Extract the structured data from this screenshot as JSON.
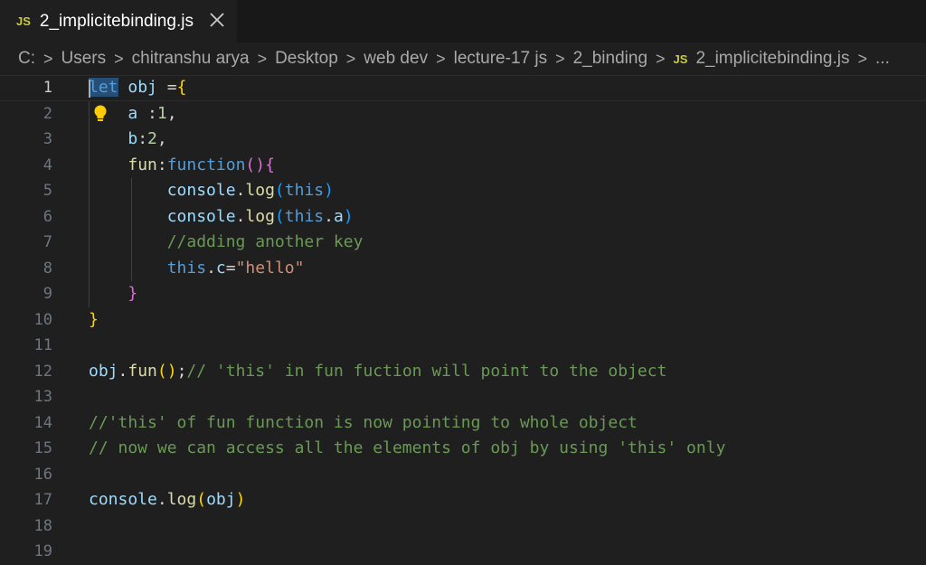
{
  "tab": {
    "badge": "JS",
    "title": "2_implicitebinding.js"
  },
  "breadcrumb": {
    "items": [
      "C:",
      "Users",
      "chitranshu arya",
      "Desktop",
      "web dev",
      "lecture-17 js",
      "2_binding"
    ],
    "file_badge": "JS",
    "file": "2_implicitebinding.js",
    "more": "..."
  },
  "editor": {
    "active_line": 1,
    "line_numbers": [
      "1",
      "2",
      "3",
      "4",
      "5",
      "6",
      "7",
      "8",
      "9",
      "10",
      "11",
      "12",
      "13",
      "14",
      "15",
      "16",
      "17",
      "18",
      "19"
    ],
    "lines": [
      "let obj ={",
      "    a :1,",
      "    b:2,",
      "    fun:function(){",
      "        console.log(this)",
      "        console.log(this.a)",
      "        //adding another key",
      "        this.c=\"hello\"",
      "    }",
      "}",
      "",
      "obj.fun();// 'this' in fun fuction will point to the object",
      "",
      "//'this' of fun function is now pointing to whole object",
      "// now we can access all the elements of obj by using 'this' only",
      "",
      "console.log(obj)",
      "",
      ""
    ]
  },
  "colors": {
    "keyword": "#569cd6",
    "variable": "#9cdcfe",
    "function": "#dcdcaa",
    "number": "#b5cea8",
    "string": "#ce9178",
    "comment": "#6a9955",
    "bracket1": "#ffd700",
    "bracket2": "#da70d6",
    "bracket3": "#179fff",
    "js_badge": "#cbcb41"
  },
  "icons": [
    "close-icon",
    "lightbulb-icon",
    "chevron-right-icon"
  ]
}
